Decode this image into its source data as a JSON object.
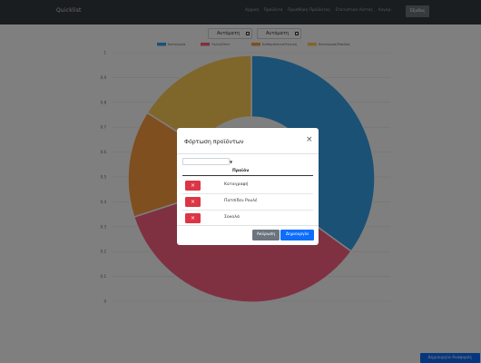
{
  "navbar": {
    "brand": "Quicklist",
    "links": [
      "Αρχική",
      "Προϊόντα",
      "Προσθήκη Προϊόντος",
      "Στατιστικά Λίστας",
      "Λογαρ."
    ],
    "logout_label": "Έξοδος"
  },
  "filters": {
    "from_label": "Από:",
    "to_label": "Έως:",
    "from_value": "Αυτόματη",
    "to_value": "Αυτόματη"
  },
  "chart_data": {
    "type": "pie",
    "variant": "doughnut",
    "legend_position": "top",
    "labels": [
      "Κατηγορία",
      "Υγεία/Σπίτι",
      "Καθαριότητα/Υγιεινή",
      "Κατηγορία/Είσοδος"
    ],
    "values": [
      35,
      35,
      14,
      16
    ],
    "colors": [
      "#36a2eb",
      "#ff6384",
      "#ff9f40",
      "#ffcd56"
    ],
    "y_ticks": [
      "1",
      "0.9",
      "0.8",
      "0.7",
      "0.6",
      "0.5",
      "0.4",
      "0.3",
      "0.2",
      "0.1",
      "0"
    ],
    "grid": true
  },
  "report_button_label": "Δημιουργία Αναφοράς",
  "modal": {
    "title": "Φόρτωση προϊόντων",
    "close_symbol": "×",
    "select_value": "",
    "column_header": "Προϊόν",
    "delete_symbol": "×",
    "rows": [
      {
        "name": "Καταγραφή"
      },
      {
        "name": "Πατσίδεν Ρουλέ"
      },
      {
        "name": "Σοκολά"
      }
    ],
    "cancel_label": "Ακύρωση",
    "create_label": "Δημιουργία"
  }
}
